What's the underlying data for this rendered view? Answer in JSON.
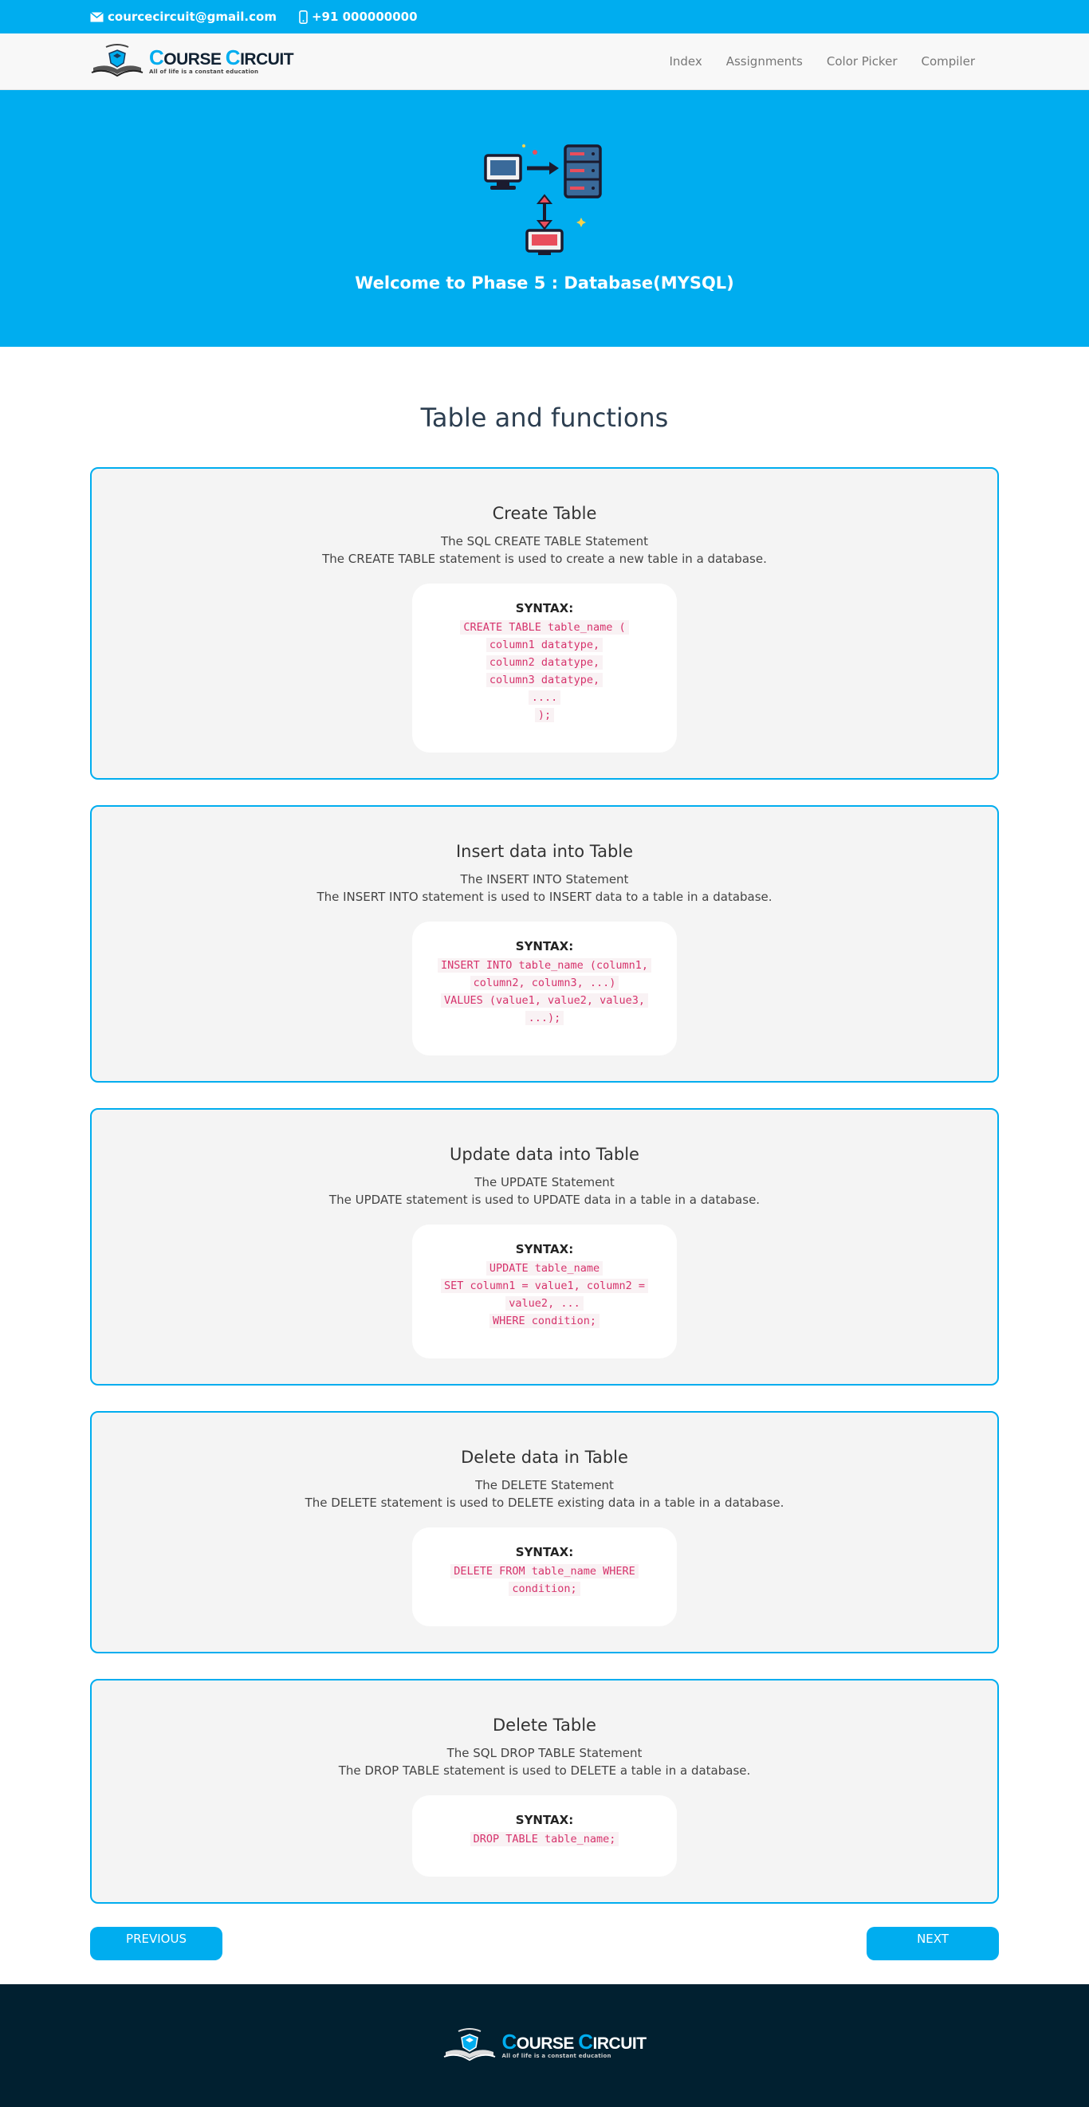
{
  "topbar": {
    "email": "courcecircuit@gmail.com",
    "phone": "+91 000000000",
    "email_icon": "envelope-icon",
    "phone_icon": "mobile-phone-icon"
  },
  "brand": {
    "logo_first": "C",
    "logo_rest1": "OURSE ",
    "logo_second": "C",
    "logo_rest2": "IRCUIT",
    "tagline": "All of life is a constant education"
  },
  "nav": {
    "links": [
      "Index",
      "Assignments",
      "Color Picker",
      "Compiler"
    ]
  },
  "hero": {
    "title": "Welcome to Phase 5 : Database(MYSQL)",
    "illustration": "database-network-icon"
  },
  "page": {
    "title": "Table and functions"
  },
  "cards": [
    {
      "title": "Create Table",
      "subtitle": "The SQL CREATE TABLE Statement",
      "description": "The CREATE TABLE statement is used to create a new table in a database.",
      "syntax_label": "SYNTAX:",
      "code": [
        "CREATE TABLE table_name (",
        "column1 datatype,",
        "column2 datatype,",
        "column3 datatype,",
        "....",
        ");"
      ]
    },
    {
      "title": "Insert data into Table",
      "subtitle": "The INSERT INTO Statement",
      "description": "The INSERT INTO statement is used to INSERT data to a table in a database.",
      "syntax_label": "SYNTAX:",
      "code": [
        "INSERT INTO table_name (column1,",
        "column2, column3, ...)",
        "VALUES (value1, value2, value3,",
        "...);"
      ]
    },
    {
      "title": "Update data into Table",
      "subtitle": "The UPDATE Statement",
      "description": "The UPDATE statement is used to UPDATE data in a table in a database.",
      "syntax_label": "SYNTAX:",
      "code": [
        "UPDATE table_name",
        "SET column1 = value1, column2 =",
        "value2, ...",
        "WHERE condition;"
      ]
    },
    {
      "title": "Delete data in Table",
      "subtitle": "The DELETE Statement",
      "description": "The DELETE statement is used to DELETE existing data in a table in a database.",
      "syntax_label": "SYNTAX:",
      "code": [
        "DELETE FROM table_name WHERE",
        "condition;"
      ]
    },
    {
      "title": "Delete Table",
      "subtitle": "The SQL DROP TABLE Statement",
      "description": "The DROP TABLE statement is used to DELETE a table in a database.",
      "syntax_label": "SYNTAX:",
      "code": [
        "DROP TABLE table_name;"
      ]
    }
  ],
  "buttons": {
    "previous": "PREVIOUS",
    "next": "NEXT"
  },
  "colors": {
    "accent": "#00adef",
    "footer": "#012030",
    "code": "#d6336c"
  }
}
